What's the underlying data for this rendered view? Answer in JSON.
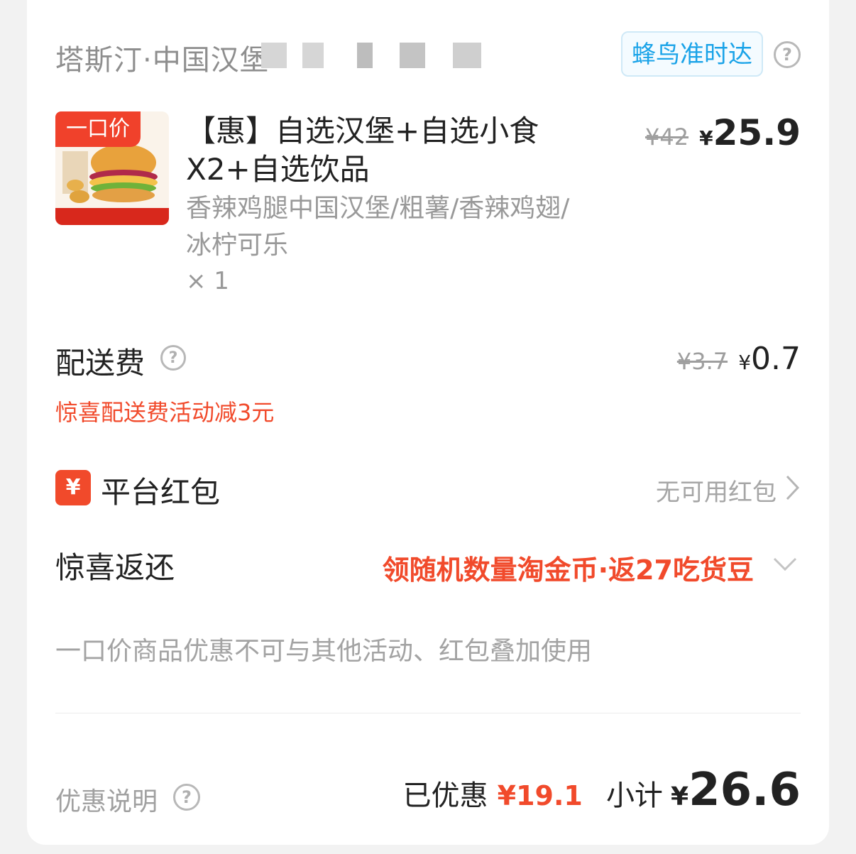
{
  "store": {
    "name": "塔斯汀·中国汉堡",
    "delivery_badge": "蜂鸟准时达"
  },
  "item": {
    "tag": "一口价",
    "title": "【惠】自选汉堡+自选小食X2+自选饮品",
    "options": "香辣鸡腿中国汉堡/粗薯/香辣鸡翅/冰柠可乐",
    "quantity": "× 1",
    "original_price": "¥42",
    "currency": "¥",
    "price": "25.9"
  },
  "delivery_fee": {
    "label": "配送费",
    "original_price": "¥3.7",
    "currency": "¥",
    "price": "0.7",
    "promo": "惊喜配送费活动减3元"
  },
  "platform_redpacket": {
    "icon_text": "¥",
    "label": "平台红包",
    "value": "无可用红包"
  },
  "surprise_return": {
    "label": "惊喜返还",
    "value": "领随机数量淘金币·返27吃货豆"
  },
  "notice": "一口价商品优惠不可与其他活动、红包叠加使用",
  "footer": {
    "discount_info_label": "优惠说明",
    "saved_label": "已优惠",
    "saved_amount": "¥19.1",
    "subtotal_label": "小计",
    "subtotal_currency": "¥",
    "subtotal_amount": "26.6"
  },
  "colors": {
    "accent_red": "#f14a2b",
    "badge_blue": "#1aa3e8"
  }
}
